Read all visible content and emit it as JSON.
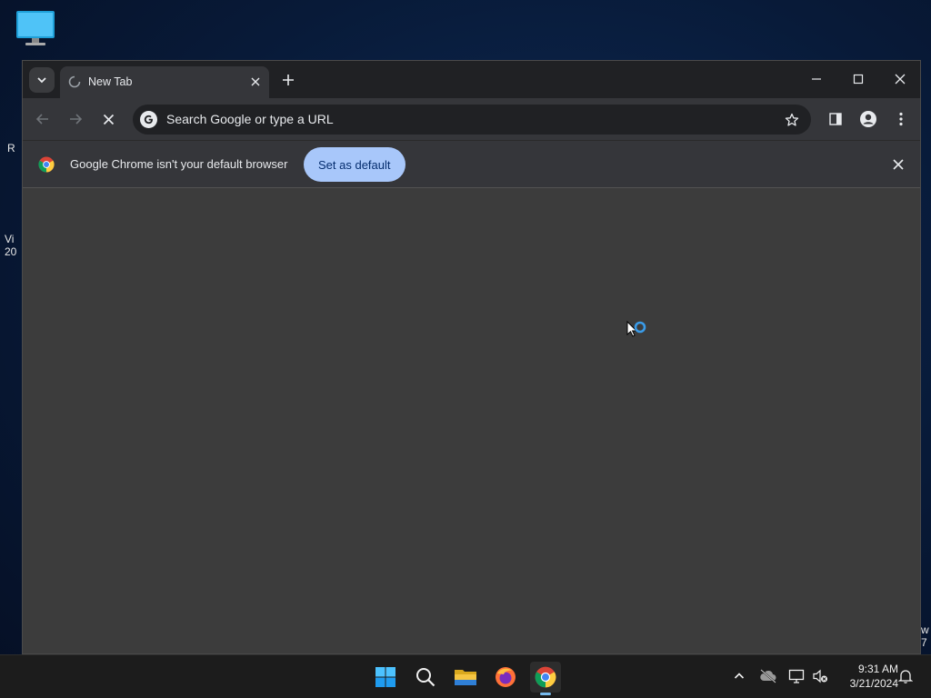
{
  "desktop": {
    "partial_labels": [
      "R",
      "Vi",
      "20",
      "w",
      "7"
    ]
  },
  "browser": {
    "tab": {
      "title": "New Tab"
    },
    "omnibox": {
      "placeholder": "Search Google or type a URL"
    },
    "infobar": {
      "message": "Google Chrome isn't your default browser",
      "button_label": "Set as default"
    }
  },
  "taskbar": {
    "apps": [
      "windows-start",
      "search",
      "file-explorer",
      "firefox",
      "chrome"
    ],
    "clock": {
      "time": "9:31 AM",
      "date": "3/21/2024"
    }
  },
  "colors": {
    "accent": "#a8c7fa",
    "loading_ring": "#3a9be8"
  }
}
